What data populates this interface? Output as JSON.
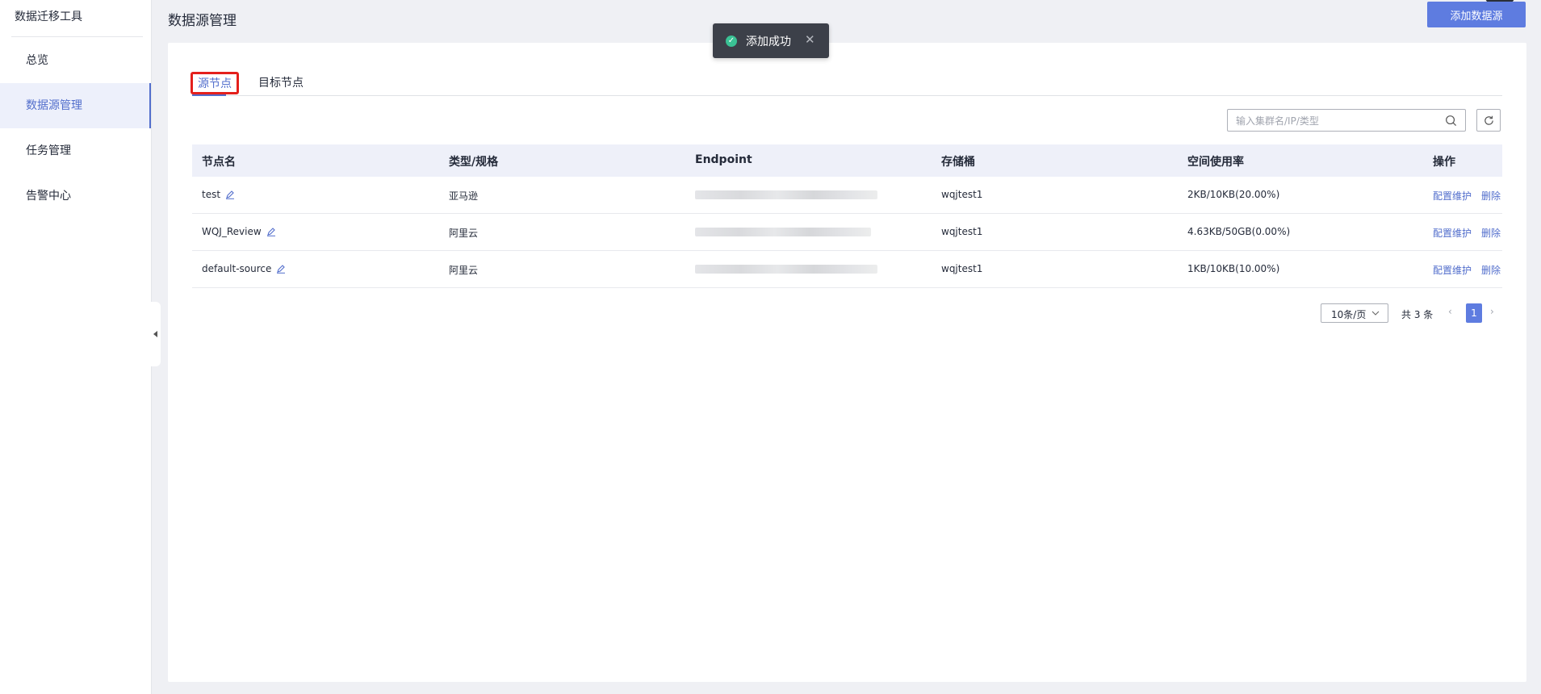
{
  "app": {
    "title": "数据迁移工具"
  },
  "sidebar": {
    "items": [
      {
        "label": "总览",
        "active": false
      },
      {
        "label": "数据源管理",
        "active": true
      },
      {
        "label": "任务管理",
        "active": false
      },
      {
        "label": "告警中心",
        "active": false
      }
    ]
  },
  "header": {
    "title": "数据源管理",
    "add_button": "添加数据源"
  },
  "toast": {
    "message": "添加成功",
    "close": "✕"
  },
  "tabs": [
    {
      "label": "源节点",
      "active": true
    },
    {
      "label": "目标节点",
      "active": false
    }
  ],
  "search": {
    "placeholder": "输入集群名/IP/类型"
  },
  "table": {
    "columns": [
      "节点名",
      "类型/规格",
      "Endpoint",
      "存储桶",
      "空间使用率",
      "操作"
    ],
    "rows": [
      {
        "name": "test",
        "type": "亚马逊",
        "bucket": "wqjtest1",
        "usage": "2KB/10KB(20.00%)"
      },
      {
        "name": "WQJ_Review",
        "type": "阿里云",
        "bucket": "wqjtest1",
        "usage": "4.63KB/50GB(0.00%)"
      },
      {
        "name": "default-source",
        "type": "阿里云",
        "bucket": "wqjtest1",
        "usage": "1KB/10KB(10.00%)"
      }
    ],
    "actions": {
      "configure": "配置维护",
      "delete": "删除"
    }
  },
  "pagination": {
    "page_size": "10条/页",
    "total": "共 3 条",
    "current_page": "1",
    "prev": "‹",
    "next": "›"
  },
  "colors": {
    "primary": "#5e7ce0",
    "link": "#526ecc",
    "highlight_border": "#e4201c",
    "success": "#3ac295"
  }
}
